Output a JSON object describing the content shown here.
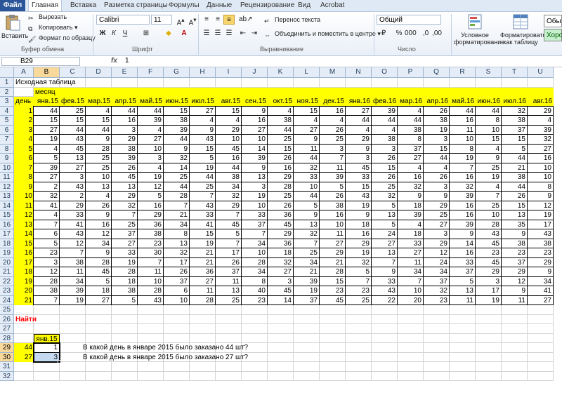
{
  "ribbon": {
    "tabs": [
      "Файл",
      "Главная",
      "Вставка",
      "Разметка страницы",
      "Формулы",
      "Данные",
      "Рецензирование",
      "Вид",
      "Acrobat"
    ],
    "clipboard": {
      "paste": "Вставить",
      "cut": "Вырезать",
      "copy": "Копировать",
      "format_painter": "Формат по образцу",
      "label": "Буфер обмена"
    },
    "font": {
      "name": "Calibri",
      "size": "11",
      "label": "Шрифт"
    },
    "alignment": {
      "wrap": "Перенос текста",
      "merge": "Объединить и поместить в центре",
      "label": "Выравнивание"
    },
    "number": {
      "format": "Общий",
      "label": "Число"
    },
    "styles": {
      "conditional": "Условное форматирование",
      "format_table": "Форматировать как таблицу",
      "style_normal": "Обы",
      "style_good": "Хоро"
    }
  },
  "formula_bar": {
    "name_box": "B29",
    "fx": "fx",
    "value": "1"
  },
  "columns": [
    "A",
    "B",
    "C",
    "D",
    "E",
    "F",
    "G",
    "H",
    "I",
    "J",
    "K",
    "L",
    "M",
    "N",
    "O",
    "P",
    "Q",
    "R",
    "S",
    "T",
    "U"
  ],
  "rows": [
    1,
    2,
    3,
    4,
    5,
    6,
    7,
    8,
    9,
    10,
    11,
    12,
    13,
    14,
    15,
    16,
    17,
    18,
    19,
    20,
    21,
    22,
    23,
    24,
    25,
    26,
    27,
    28,
    29,
    30,
    31,
    32
  ],
  "sheet": {
    "title": "Исходная таблица",
    "month_label": "месяц",
    "day_label": "день",
    "months": [
      "янв.15",
      "фев.15",
      "мар.15",
      "апр.15",
      "май.15",
      "июн.15",
      "июл.15",
      "авг.15",
      "сен.15",
      "окт.15",
      "ноя.15",
      "дек.15",
      "янв.16",
      "фев.16",
      "мар.16",
      "апр.16",
      "май.16",
      "июн.16",
      "июл.16",
      "авг.16"
    ],
    "days": [
      1,
      2,
      3,
      4,
      5,
      6,
      7,
      8,
      9,
      10,
      11,
      12,
      13,
      14,
      15,
      16,
      17,
      18,
      19,
      20,
      21
    ],
    "table": [
      [
        44,
        25,
        4,
        44,
        44,
        15,
        27,
        15,
        9,
        4,
        15,
        16,
        27,
        39,
        4,
        26,
        44,
        44,
        32,
        29
      ],
      [
        15,
        15,
        15,
        16,
        39,
        38,
        4,
        4,
        16,
        38,
        4,
        4,
        44,
        44,
        44,
        38,
        16,
        8,
        38,
        4
      ],
      [
        27,
        44,
        44,
        3,
        4,
        39,
        9,
        29,
        27,
        44,
        27,
        26,
        4,
        4,
        38,
        19,
        11,
        10,
        37,
        39
      ],
      [
        19,
        43,
        9,
        29,
        27,
        44,
        43,
        10,
        10,
        25,
        9,
        25,
        29,
        38,
        8,
        3,
        10,
        15,
        15,
        32
      ],
      [
        4,
        45,
        28,
        38,
        10,
        9,
        15,
        45,
        14,
        15,
        11,
        3,
        9,
        3,
        37,
        15,
        8,
        4,
        5,
        27
      ],
      [
        5,
        13,
        25,
        39,
        3,
        32,
        5,
        16,
        39,
        26,
        44,
        7,
        3,
        26,
        27,
        44,
        19,
        9,
        44,
        16
      ],
      [
        39,
        27,
        25,
        26,
        4,
        14,
        19,
        44,
        9,
        16,
        32,
        11,
        45,
        15,
        4,
        4,
        7,
        25,
        21,
        10
      ],
      [
        27,
        3,
        10,
        45,
        19,
        25,
        44,
        38,
        13,
        29,
        33,
        39,
        33,
        26,
        16,
        26,
        16,
        19,
        38,
        10
      ],
      [
        2,
        43,
        13,
        13,
        12,
        44,
        25,
        34,
        3,
        28,
        10,
        5,
        15,
        25,
        32,
        3,
        32,
        4,
        44,
        8
      ],
      [
        32,
        2,
        4,
        29,
        5,
        28,
        7,
        32,
        19,
        25,
        44,
        26,
        43,
        32,
        9,
        9,
        39,
        7,
        26,
        9
      ],
      [
        41,
        29,
        26,
        32,
        16,
        7,
        43,
        29,
        10,
        26,
        5,
        38,
        19,
        5,
        18,
        29,
        16,
        25,
        15,
        12
      ],
      [
        4,
        33,
        9,
        7,
        29,
        21,
        33,
        7,
        33,
        36,
        9,
        16,
        9,
        13,
        39,
        25,
        16,
        10,
        13,
        19
      ],
      [
        7,
        41,
        16,
        25,
        36,
        34,
        41,
        45,
        37,
        45,
        13,
        10,
        18,
        5,
        4,
        27,
        39,
        28,
        35,
        17
      ],
      [
        6,
        43,
        12,
        37,
        38,
        8,
        15,
        5,
        7,
        29,
        32,
        11,
        16,
        24,
        18,
        3,
        9,
        43,
        9,
        43
      ],
      [
        5,
        12,
        34,
        27,
        23,
        13,
        19,
        7,
        34,
        36,
        7,
        27,
        29,
        27,
        33,
        29,
        14,
        45,
        38,
        38
      ],
      [
        23,
        7,
        9,
        33,
        30,
        32,
        21,
        17,
        10,
        18,
        25,
        29,
        19,
        13,
        27,
        12,
        16,
        23,
        23,
        23
      ],
      [
        3,
        38,
        28,
        19,
        7,
        17,
        21,
        26,
        28,
        32,
        34,
        21,
        32,
        7,
        11,
        24,
        33,
        45,
        37,
        29
      ],
      [
        12,
        11,
        45,
        28,
        11,
        26,
        36,
        37,
        34,
        27,
        21,
        28,
        5,
        9,
        34,
        34,
        37,
        29,
        29,
        9
      ],
      [
        28,
        34,
        5,
        18,
        10,
        37,
        27,
        11,
        8,
        3,
        39,
        15,
        7,
        33,
        7,
        37,
        5,
        3,
        12,
        34
      ],
      [
        38,
        39,
        18,
        38,
        28,
        6,
        11,
        13,
        40,
        45,
        19,
        23,
        23,
        43,
        10,
        32,
        13,
        17,
        9,
        41
      ],
      [
        7,
        19,
        27,
        5,
        43,
        10,
        28,
        25,
        23,
        14,
        37,
        45,
        25,
        22,
        20,
        23,
        11,
        19,
        11,
        27
      ]
    ],
    "find_label": "Найти",
    "find_month": "янв.15",
    "find_rows": [
      {
        "a": "44",
        "b": "1",
        "question": "В какой день в январе 2015 было заказано 44 шт?"
      },
      {
        "a": "27",
        "b": "3",
        "question": "В какой день в январе 2015 было заказано 27 шт?"
      }
    ]
  }
}
